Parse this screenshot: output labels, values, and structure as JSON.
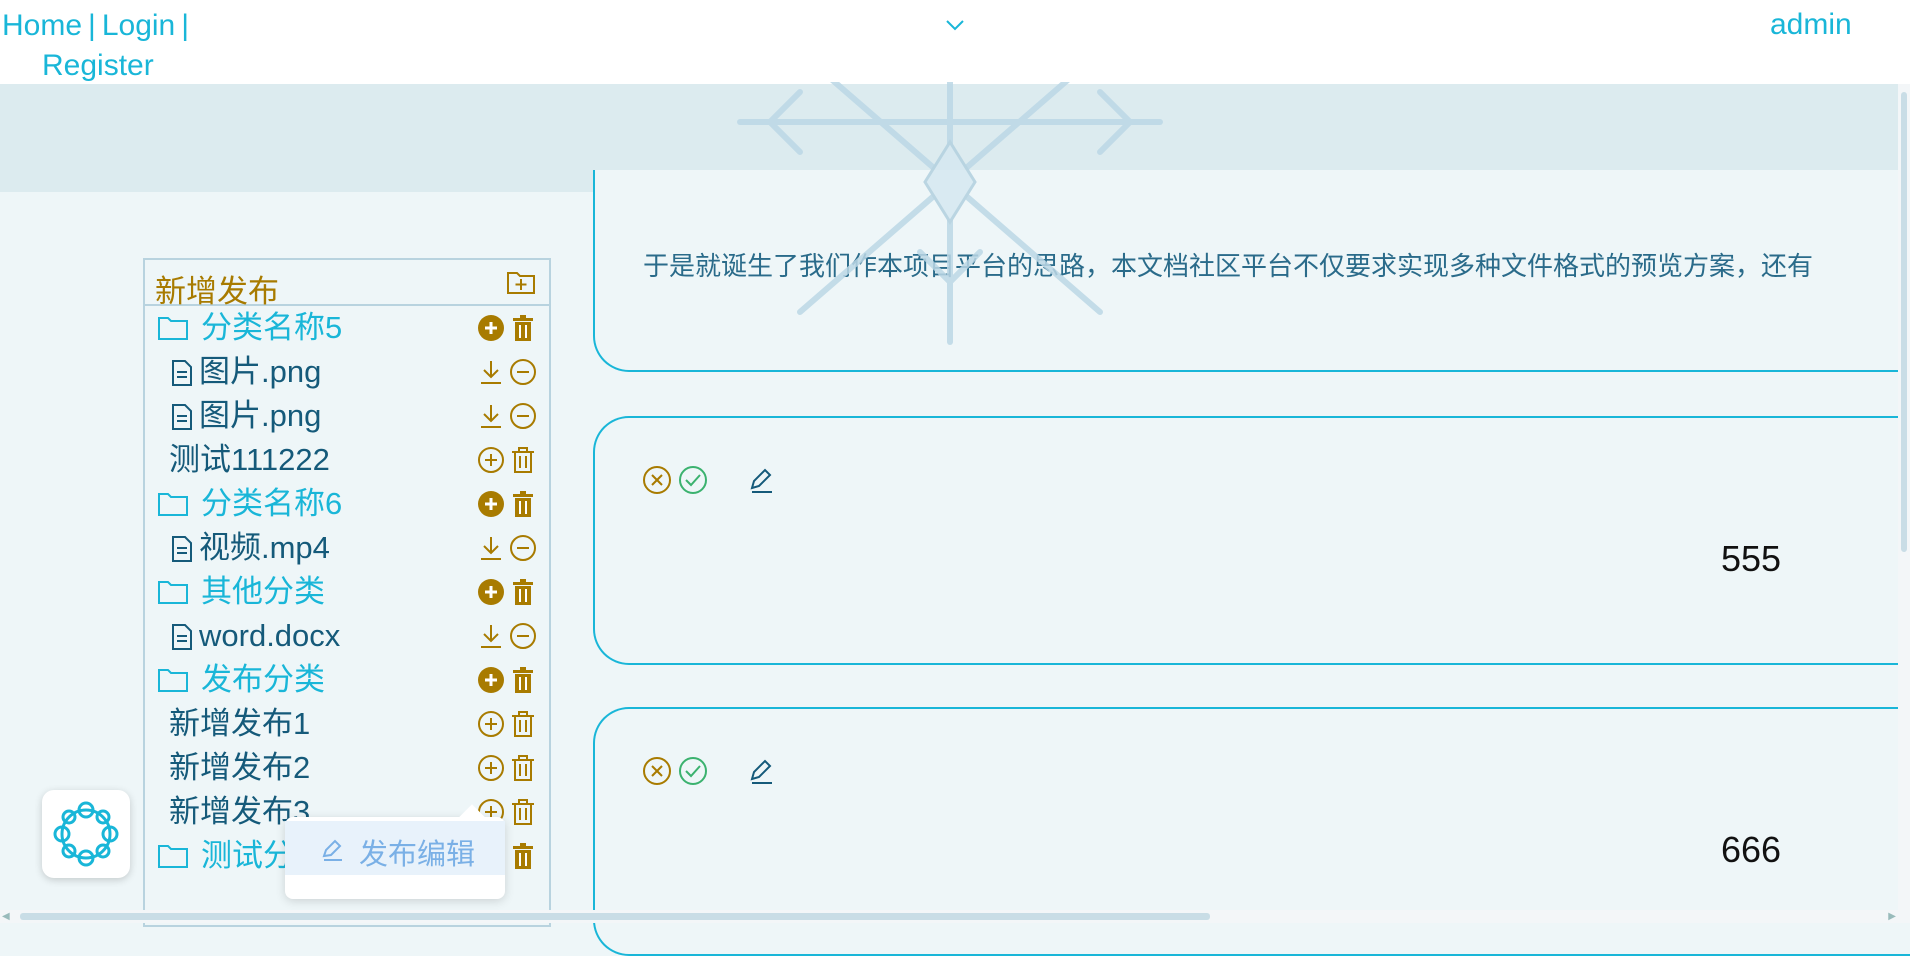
{
  "nav": {
    "home": "Home",
    "login": "Login",
    "register": "Register",
    "separator": "|",
    "user": "admin"
  },
  "sidebar": {
    "title": "新增发布",
    "rows": [
      {
        "type": "category",
        "label": "分类名称5"
      },
      {
        "type": "file",
        "label": "图片.png"
      },
      {
        "type": "file",
        "label": "图片.png"
      },
      {
        "type": "item",
        "label": "测试111222"
      },
      {
        "type": "category",
        "label": "分类名称6"
      },
      {
        "type": "file",
        "label": "视频.mp4"
      },
      {
        "type": "category",
        "label": "其他分类"
      },
      {
        "type": "file",
        "label": "word.docx"
      },
      {
        "type": "category",
        "label": "发布分类"
      },
      {
        "type": "item",
        "label": "新增发布1"
      },
      {
        "type": "item",
        "label": "新增发布2"
      },
      {
        "type": "item",
        "label": "新增发布3"
      },
      {
        "type": "category",
        "label": "测试分"
      }
    ]
  },
  "posts": [
    {
      "text": "于是就诞生了我们作本项目平台的思路，本文档社区平台不仅要求实现多种文件格式的预览方案，还有"
    },
    {
      "value": "555"
    },
    {
      "value": "666"
    }
  ],
  "popup": {
    "label": "发布编辑"
  },
  "colors": {
    "accent": "#19b6d8",
    "gold": "#a87b00",
    "text_dark": "#155a7a",
    "success": "#3bb26f"
  }
}
